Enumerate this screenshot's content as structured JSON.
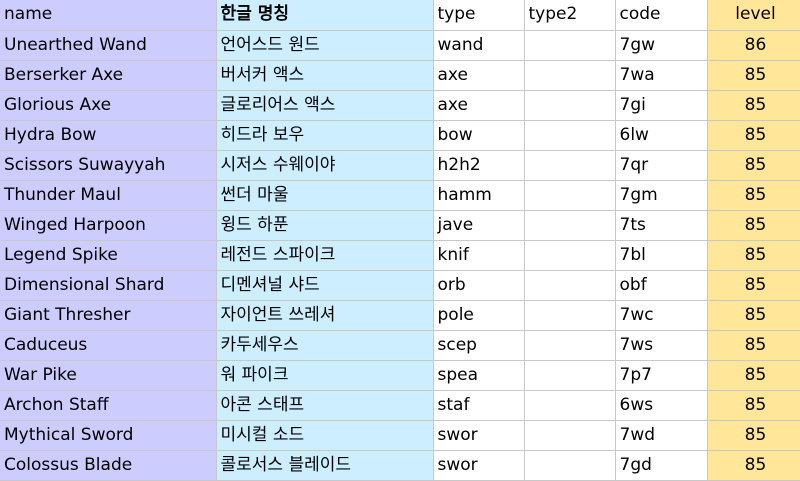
{
  "headers": {
    "name": "name",
    "korean": "한글 명칭",
    "type": "type",
    "type2": "type2",
    "code": "code",
    "level": "level"
  },
  "colors": {
    "name_column": "#ccccff",
    "korean_column": "#cceeff",
    "level_column": "#ffe699",
    "gridlines": "#c8c8c8"
  },
  "rows": [
    {
      "name": "Unearthed Wand",
      "korean": "언어스드 원드",
      "type": "wand",
      "type2": "",
      "code": "7gw",
      "level": "86"
    },
    {
      "name": "Berserker Axe",
      "korean": "버서커 액스",
      "type": "axe",
      "type2": "",
      "code": "7wa",
      "level": "85"
    },
    {
      "name": "Glorious Axe",
      "korean": "글로리어스 액스",
      "type": "axe",
      "type2": "",
      "code": "7gi",
      "level": "85"
    },
    {
      "name": "Hydra Bow",
      "korean": "히드라 보우",
      "type": "bow",
      "type2": "",
      "code": "6lw",
      "level": "85"
    },
    {
      "name": "Scissors Suwayyah",
      "korean": "시저스 수웨이야",
      "type": "h2h2",
      "type2": "",
      "code": "7qr",
      "level": "85"
    },
    {
      "name": "Thunder Maul",
      "korean": "썬더 마울",
      "type": "hamm",
      "type2": "",
      "code": "7gm",
      "level": "85"
    },
    {
      "name": "Winged Harpoon",
      "korean": "윙드 하푼",
      "type": "jave",
      "type2": "",
      "code": "7ts",
      "level": "85"
    },
    {
      "name": "Legend Spike",
      "korean": "레전드 스파이크",
      "type": "knif",
      "type2": "",
      "code": "7bl",
      "level": "85"
    },
    {
      "name": "Dimensional Shard",
      "korean": "디멘셔널 샤드",
      "type": "orb",
      "type2": "",
      "code": "obf",
      "level": "85"
    },
    {
      "name": "Giant Thresher",
      "korean": "자이언트 쓰레셔",
      "type": "pole",
      "type2": "",
      "code": "7wc",
      "level": "85"
    },
    {
      "name": "Caduceus",
      "korean": "카두세우스",
      "type": "scep",
      "type2": "",
      "code": "7ws",
      "level": "85"
    },
    {
      "name": "War Pike",
      "korean": "워 파이크",
      "type": "spea",
      "type2": "",
      "code": "7p7",
      "level": "85"
    },
    {
      "name": "Archon Staff",
      "korean": "아콘 스태프",
      "type": "staf",
      "type2": "",
      "code": "6ws",
      "level": "85"
    },
    {
      "name": "Mythical Sword",
      "korean": "미시컬 소드",
      "type": "swor",
      "type2": "",
      "code": "7wd",
      "level": "85"
    },
    {
      "name": "Colossus Blade",
      "korean": "콜로서스 블레이드",
      "type": "swor",
      "type2": "",
      "code": "7gd",
      "level": "85"
    }
  ]
}
